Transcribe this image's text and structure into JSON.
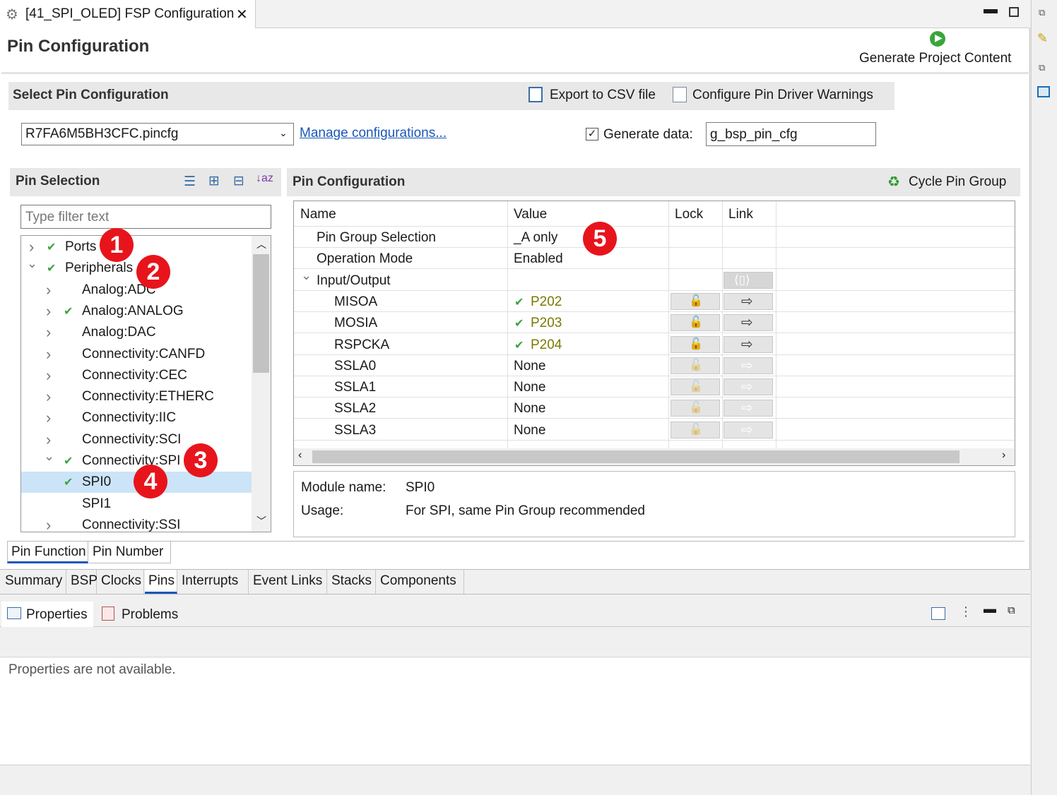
{
  "window": {
    "tab_title": "[41_SPI_OLED] FSP Configuration",
    "page_title": "Pin Configuration",
    "generate_label": "Generate Project Content"
  },
  "select_config": {
    "header": "Select Pin Configuration",
    "export_csv": "Export to CSV file",
    "configure_warnings": "Configure Pin Driver Warnings",
    "selected_file": "R7FA6M5BH3CFC.pincfg",
    "manage_link": "Manage configurations...",
    "generate_data_label": "Generate data:",
    "generate_data_checked": true,
    "generate_data_value": "g_bsp_pin_cfg"
  },
  "pin_selection": {
    "header": "Pin Selection",
    "filter_placeholder": "Type filter text",
    "tree": [
      {
        "label": "Ports",
        "expanded": false,
        "checked": true,
        "level": 0
      },
      {
        "label": "Peripherals",
        "expanded": true,
        "checked": true,
        "level": 0
      },
      {
        "label": "Analog:ADC",
        "expanded": false,
        "checked": false,
        "level": 1
      },
      {
        "label": "Analog:ANALOG",
        "expanded": false,
        "checked": true,
        "level": 1
      },
      {
        "label": "Analog:DAC",
        "expanded": false,
        "checked": false,
        "level": 1
      },
      {
        "label": "Connectivity:CANFD",
        "expanded": false,
        "checked": false,
        "level": 1
      },
      {
        "label": "Connectivity:CEC",
        "expanded": false,
        "checked": false,
        "level": 1
      },
      {
        "label": "Connectivity:ETHERC",
        "expanded": false,
        "checked": false,
        "level": 1
      },
      {
        "label": "Connectivity:IIC",
        "expanded": false,
        "checked": false,
        "level": 1
      },
      {
        "label": "Connectivity:SCI",
        "expanded": false,
        "checked": false,
        "level": 1
      },
      {
        "label": "Connectivity:SPI",
        "expanded": true,
        "checked": true,
        "level": 1
      },
      {
        "label": "SPI0",
        "expanded": false,
        "checked": true,
        "level": 2,
        "selected": true
      },
      {
        "label": "SPI1",
        "expanded": false,
        "checked": false,
        "level": 2
      },
      {
        "label": "Connectivity:SSI",
        "expanded": false,
        "checked": false,
        "level": 1
      }
    ]
  },
  "pin_config": {
    "header": "Pin Configuration",
    "cycle_label": "Cycle Pin Group",
    "columns": [
      "Name",
      "Value",
      "Lock",
      "Link"
    ],
    "rows": [
      {
        "name": "Pin Group Selection",
        "value": "_A only"
      },
      {
        "name": "Operation Mode",
        "value": "Enabled"
      },
      {
        "name": "Input/Output",
        "value": ""
      },
      {
        "name": "MISOA",
        "value": "P202"
      },
      {
        "name": "MOSIA",
        "value": "P203"
      },
      {
        "name": "RSPCKA",
        "value": "P204"
      },
      {
        "name": "SSLA0",
        "value": "None"
      },
      {
        "name": "SSLA1",
        "value": "None"
      },
      {
        "name": "SSLA2",
        "value": "None"
      },
      {
        "name": "SSLA3",
        "value": "None"
      }
    ],
    "module_name_label": "Module name:",
    "module_name_value": "SPI0",
    "usage_label": "Usage:",
    "usage_value": "For SPI, same Pin Group recommended"
  },
  "sub_tabs": [
    "Pin Function",
    "Pin Number"
  ],
  "bottom_tabs": [
    "Summary",
    "BSP",
    "Clocks",
    "Pins",
    "Interrupts",
    "Event Links",
    "Stacks",
    "Components"
  ],
  "views": {
    "properties_tab": "Properties",
    "problems_tab": "Problems",
    "empty_message": "Properties are not available."
  },
  "badges": [
    "1",
    "2",
    "3",
    "4",
    "5"
  ],
  "colors": {
    "accent": "#1a57b8",
    "badge": "#e8141c",
    "check": "#3da33d",
    "selection": "#cce4f7",
    "pin_value": "#7a7a00"
  }
}
